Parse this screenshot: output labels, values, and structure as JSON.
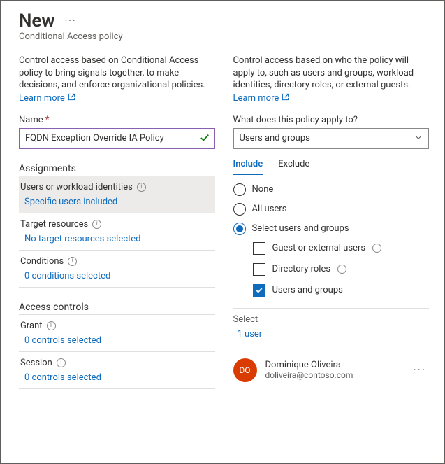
{
  "header": {
    "title": "New",
    "subtitle": "Conditional Access policy"
  },
  "left": {
    "desc": "Control access based on Conditional Access policy to bring signals together, to make decisions, and enforce organizational policies.",
    "learn": "Learn more",
    "name_label": "Name",
    "name_value": "FQDN Exception Override IA Policy",
    "assignments_h": "Assignments",
    "rows": {
      "users": {
        "title": "Users or workload identities",
        "sub": "Specific users included"
      },
      "target": {
        "title": "Target resources",
        "sub": "No target resources selected"
      },
      "cond": {
        "title": "Conditions",
        "sub": "0 conditions selected"
      }
    },
    "access_h": "Access controls",
    "grant": {
      "title": "Grant",
      "sub": "0 controls selected"
    },
    "session": {
      "title": "Session",
      "sub": "0 controls selected"
    }
  },
  "right": {
    "desc": "Control access based on who the policy will apply to, such as users and groups, workload identities, directory roles, or external guests.",
    "learn": "Learn more",
    "apply_label": "What does this policy apply to?",
    "apply_value": "Users and groups",
    "tabs": {
      "include": "Include",
      "exclude": "Exclude"
    },
    "radios": {
      "none": "None",
      "all": "All users",
      "select": "Select users and groups"
    },
    "checks": {
      "guest": "Guest or external users",
      "roles": "Directory roles",
      "ug": "Users and groups"
    },
    "select_h": "Select",
    "select_link": "1 user",
    "user": {
      "initials": "DO",
      "name": "Dominique Oliveira",
      "email": "doliveira@contoso.com"
    }
  }
}
